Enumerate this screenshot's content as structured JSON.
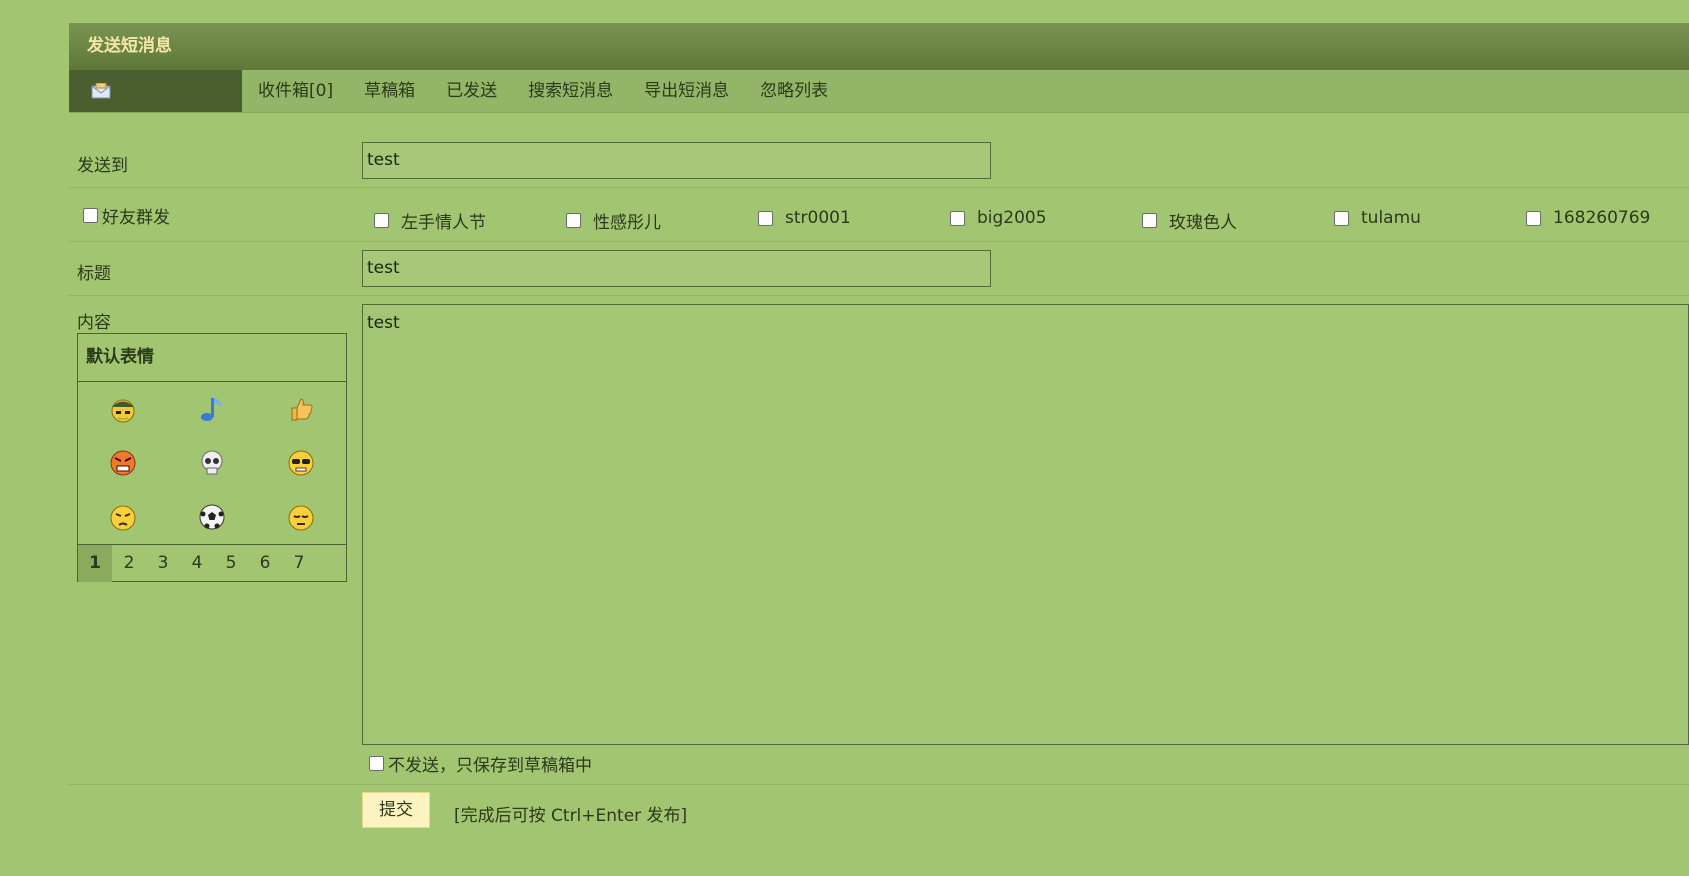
{
  "header": {
    "title": "发送短消息"
  },
  "nav": {
    "icon": "envelope-icon",
    "links": [
      "收件箱[0]",
      "草稿箱",
      "已发送",
      "搜索短消息",
      "导出短消息",
      "忽略列表"
    ]
  },
  "form": {
    "send_to": {
      "label": "发送到",
      "value": "test"
    },
    "group_send": {
      "label": "好友群发",
      "friends": [
        "左手情人节",
        "性感彤儿",
        "str0001",
        "big2005",
        "玫瑰色人",
        "tulamu",
        "168260769"
      ]
    },
    "subject": {
      "label": "标题",
      "value": "test"
    },
    "content": {
      "label": "内容",
      "value": "test"
    },
    "smilies": {
      "title": "默认表情",
      "icons": [
        "soldier-smiley-icon",
        "music-note-icon",
        "thumbs-up-icon",
        "angry-smiley-icon",
        "skull-icon",
        "cool-smiley-icon",
        "annoyed-smiley-icon",
        "soccer-ball-icon",
        "sleepy-smiley-icon"
      ],
      "pages": [
        "1",
        "2",
        "3",
        "4",
        "5",
        "6",
        "7"
      ],
      "active_page": "1"
    },
    "save_draft": {
      "label": "不发送，只保存到草稿箱中"
    },
    "submit": {
      "label": "提交",
      "hint": "[完成后可按 Ctrl+Enter 发布]"
    }
  },
  "colors": {
    "background": "#a2c572",
    "header": "#5e783a",
    "header_text": "#f4e7a6",
    "button": "#fdf3c0"
  }
}
